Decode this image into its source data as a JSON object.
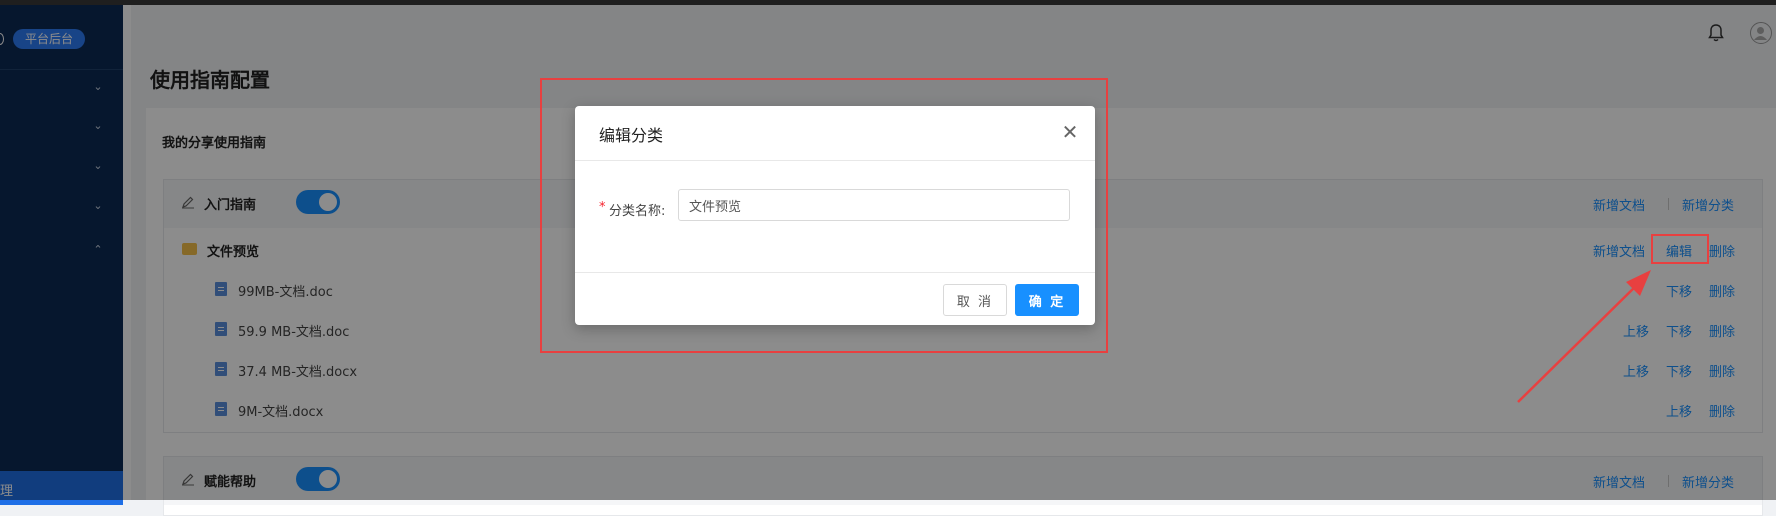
{
  "sidebar": {
    "badge": "平台后台",
    "active_item_partial": "理",
    "chevrons": [
      "chevron-down",
      "chevron-down",
      "chevron-down",
      "chevron-down",
      "chevron-up"
    ]
  },
  "page": {
    "title": "使用指南配置",
    "card_title": "我的分享使用指南"
  },
  "groups": [
    {
      "title": "入门指南",
      "enabled": true,
      "actions": [
        "新增文档",
        "新增分类"
      ],
      "folder": {
        "name": "文件预览",
        "actions": [
          "新增文档",
          "编辑",
          "删除"
        ],
        "docs": [
          {
            "name": "99MB-文档.doc",
            "actions": [
              "下移",
              "删除"
            ]
          },
          {
            "name": "59.9 MB-文档.doc",
            "actions": [
              "上移",
              "下移",
              "删除"
            ]
          },
          {
            "name": "37.4 MB-文档.docx",
            "actions": [
              "上移",
              "下移",
              "删除"
            ]
          },
          {
            "name": "9M-文档.docx",
            "actions": [
              "上移",
              "删除"
            ]
          }
        ]
      }
    },
    {
      "title": "赋能帮助",
      "enabled": true,
      "actions": [
        "新增文档",
        "新增分类"
      ]
    }
  ],
  "modal": {
    "title": "编辑分类",
    "required_mark": "*",
    "field_label": "分类名称:",
    "field_value": "文件预览",
    "cancel_label": "取 消",
    "ok_label": "确 定",
    "close_symbol": "✕"
  },
  "colors": {
    "sidebar": "#0b2a55",
    "accent": "#1890ff",
    "annotation": "#e84040"
  },
  "icons": [
    "bell-icon",
    "avatar-icon",
    "pencil-icon",
    "folder-icon",
    "doc-icon",
    "close-icon"
  ]
}
